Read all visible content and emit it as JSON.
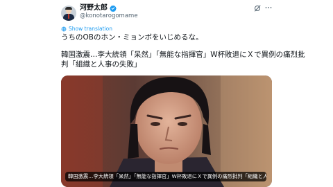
{
  "user": {
    "display_name": "河野太郎",
    "handle": "@konotarogomame"
  },
  "icons": {
    "verified": "verified-badge-icon",
    "grok": "grok-icon",
    "more": "more-icon",
    "translate": "globe-icon"
  },
  "colors": {
    "accent": "#1d9bf0",
    "text": "#0f1419",
    "muted": "#536471"
  },
  "post": {
    "translate_label": "Show translation",
    "text_line1": "うちのOBのホン・ミョンボをいじめるな。",
    "text_line2": "韓国激震…李大統領「呆然」「無能な指揮官」W杯敗退にＸで異例の痛烈批",
    "text_line3": "判「組織と人事の失敗」",
    "media_caption": "韓国激震…李大統領「呆然」「無能な指揮官」W杯敗退にＸで異例の痛烈批判「組織と人..."
  }
}
